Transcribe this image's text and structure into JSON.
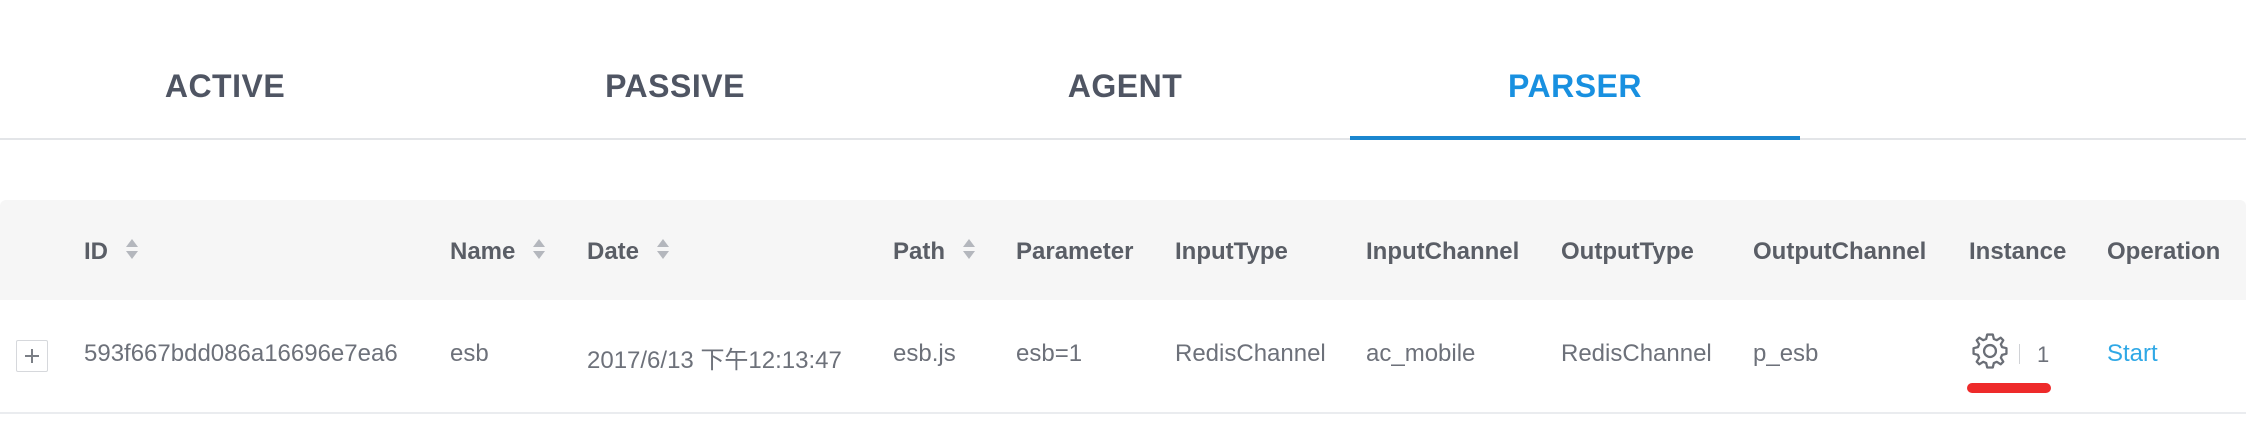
{
  "tabs": [
    {
      "label": "ACTIVE"
    },
    {
      "label": "PASSIVE"
    },
    {
      "label": "AGENT"
    },
    {
      "label": "PARSER"
    }
  ],
  "active_tab": "PARSER",
  "colors": {
    "accent": "#1890e0",
    "link": "#2fa8e6",
    "annotation": "#ee2a2a"
  },
  "table": {
    "columns": [
      {
        "label": "ID",
        "sortable": true
      },
      {
        "label": "Name",
        "sortable": true
      },
      {
        "label": "Date",
        "sortable": true
      },
      {
        "label": "Path",
        "sortable": true
      },
      {
        "label": "Parameter",
        "sortable": false
      },
      {
        "label": "InputType",
        "sortable": false
      },
      {
        "label": "InputChannel",
        "sortable": false
      },
      {
        "label": "OutputType",
        "sortable": false
      },
      {
        "label": "OutputChannel",
        "sortable": false
      },
      {
        "label": "Instance",
        "sortable": false
      },
      {
        "label": "Operation",
        "sortable": false
      }
    ],
    "rows": [
      {
        "id": "593f667bdd086a16696e7ea6",
        "name": "esb",
        "date": "2017/6/13 下午12:13:47",
        "path": "esb.js",
        "parameter": "esb=1",
        "input_type": "RedisChannel",
        "input_channel": "ac_mobile",
        "output_type": "RedisChannel",
        "output_channel": "p_esb",
        "instance": {
          "icon": "gear-icon",
          "count": "1"
        },
        "operation": "Start"
      }
    ]
  }
}
